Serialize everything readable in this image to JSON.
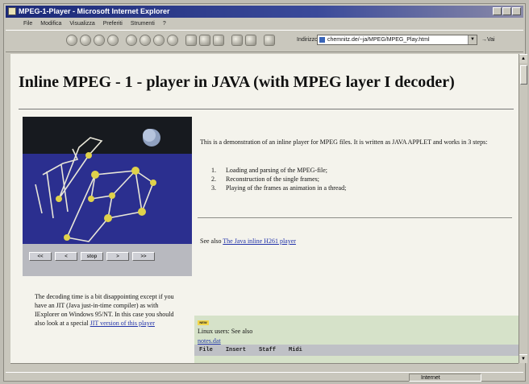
{
  "window": {
    "title": "MPEG-1-Player - Microsoft Internet Explorer"
  },
  "menu": {
    "items": [
      "File",
      "Modifica",
      "Visualizza",
      "Preferiti",
      "Strumenti",
      "?"
    ]
  },
  "address_bar": {
    "label": "Indirizzo",
    "value": "chemnitz.de/~ja/MPEG/MPEG_Play.html",
    "go_label": "Vai"
  },
  "page": {
    "title": "Inline MPEG - 1 - player in JAVA (with MPEG layer I decoder)",
    "intro": "This is a demonstration of an inline player for MPEG files. It is written as JAVA APPLET and works in 3 steps:",
    "steps": [
      "Loading and parsing of the MPEG-file;",
      "Reconstruction of the single frames;",
      "Playing of the frames as animation in a thread;"
    ],
    "see_also_prefix": "See also",
    "see_also_link": "The Java inline H261 player",
    "decoding_text_1": "The decoding time is a bit disappointing except if you have an JIT (Java just-in-time compiler) as with IExplorer on Windows 95/NT. In this case you should also look at a special",
    "decoding_link": "JIT version of this player",
    "linux_badge": "NEW",
    "linux_text": "Linux users: See also",
    "linux_link": "notes.dat"
  },
  "player": {
    "buttons": [
      "<<",
      "<",
      "stop",
      ">",
      ">>"
    ]
  },
  "applet_menu": {
    "items": [
      "File",
      "Insert",
      "Staff",
      "Midi"
    ]
  },
  "status": {
    "zone": "Internet"
  }
}
